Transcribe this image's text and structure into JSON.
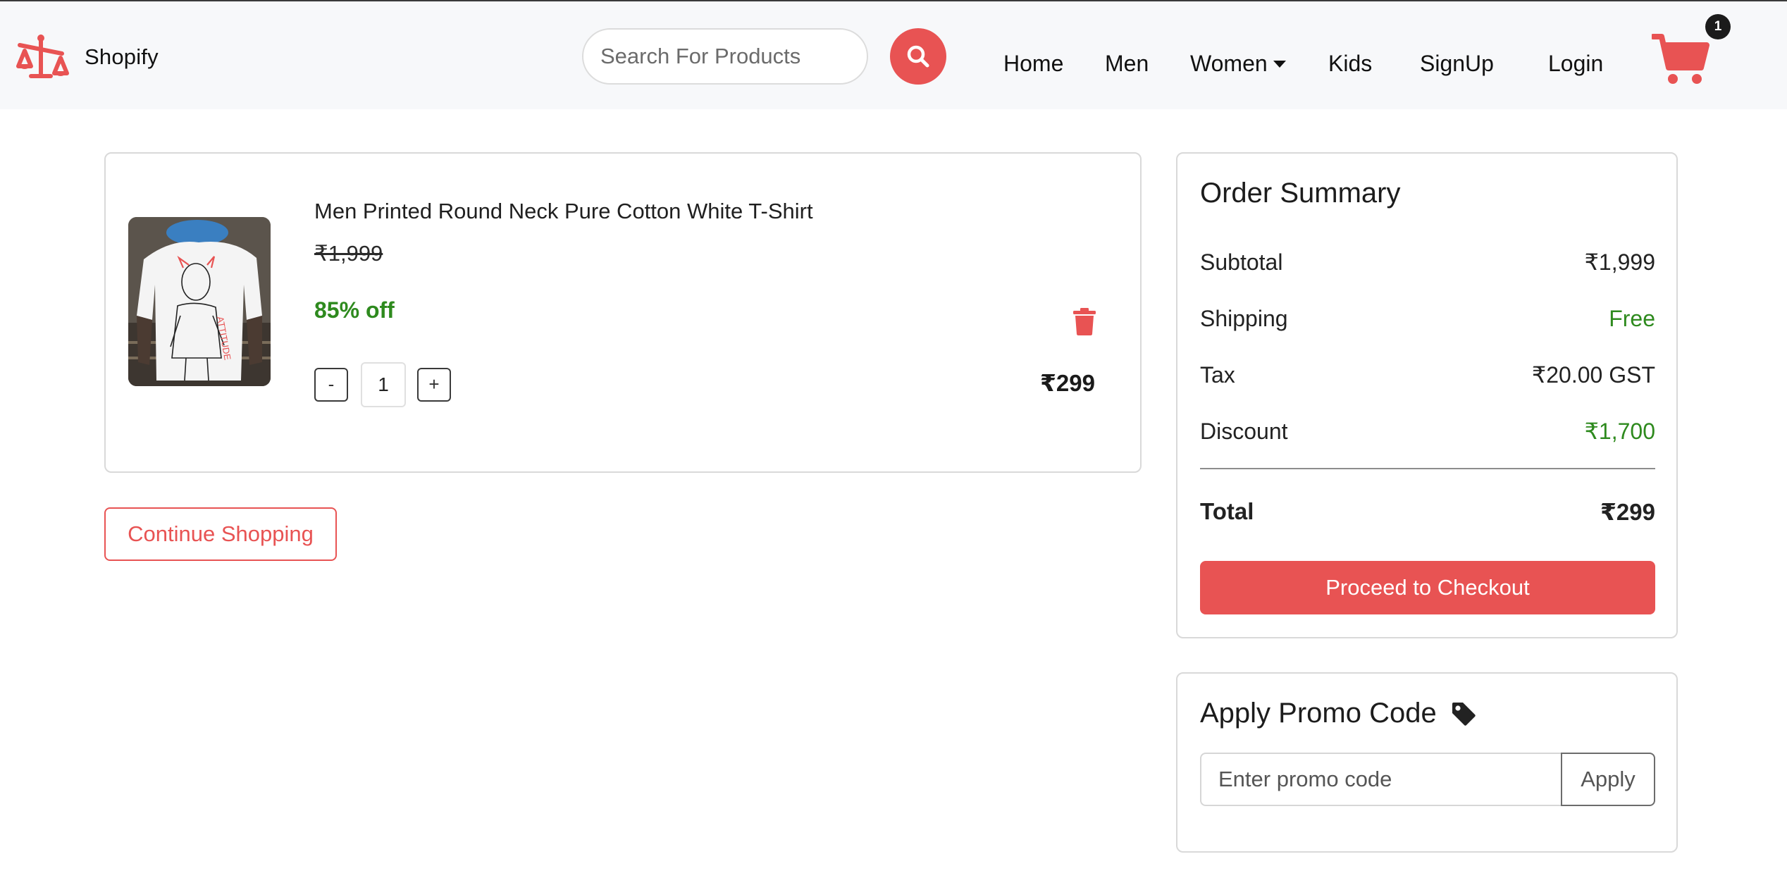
{
  "header": {
    "brand_name": "Shopify",
    "search_placeholder": "Search For Products",
    "nav": {
      "home": "Home",
      "men": "Men",
      "women": "Women",
      "kids": "Kids",
      "signup": "SignUp",
      "login": "Login"
    },
    "cart_count": "1"
  },
  "cart_item": {
    "title": "Men Printed Round Neck Pure Cotton White T-Shirt",
    "original_price": "₹1,999",
    "discount_label": "85% off",
    "quantity": "1",
    "decrement_label": "-",
    "increment_label": "+",
    "final_price": "₹299"
  },
  "continue_label": "Continue Shopping",
  "summary": {
    "title": "Order Summary",
    "subtotal_label": "Subtotal",
    "subtotal_value": "₹1,999",
    "shipping_label": "Shipping",
    "shipping_value": "Free",
    "tax_label": "Tax",
    "tax_value": "₹20.00 GST",
    "discount_label": "Discount",
    "discount_value": "₹1,700",
    "total_label": "Total",
    "total_value": "₹299",
    "checkout_label": "Proceed to Checkout"
  },
  "promo": {
    "title": "Apply Promo Code",
    "placeholder": "Enter promo code",
    "apply_label": "Apply"
  },
  "colors": {
    "accent": "#e85353",
    "success": "#2e8a1e",
    "navbar_bg": "#f7f8fa"
  },
  "icons": [
    "scale-logo-icon",
    "search-icon",
    "caret-down-icon",
    "cart-icon",
    "trash-icon",
    "tag-icon"
  ]
}
